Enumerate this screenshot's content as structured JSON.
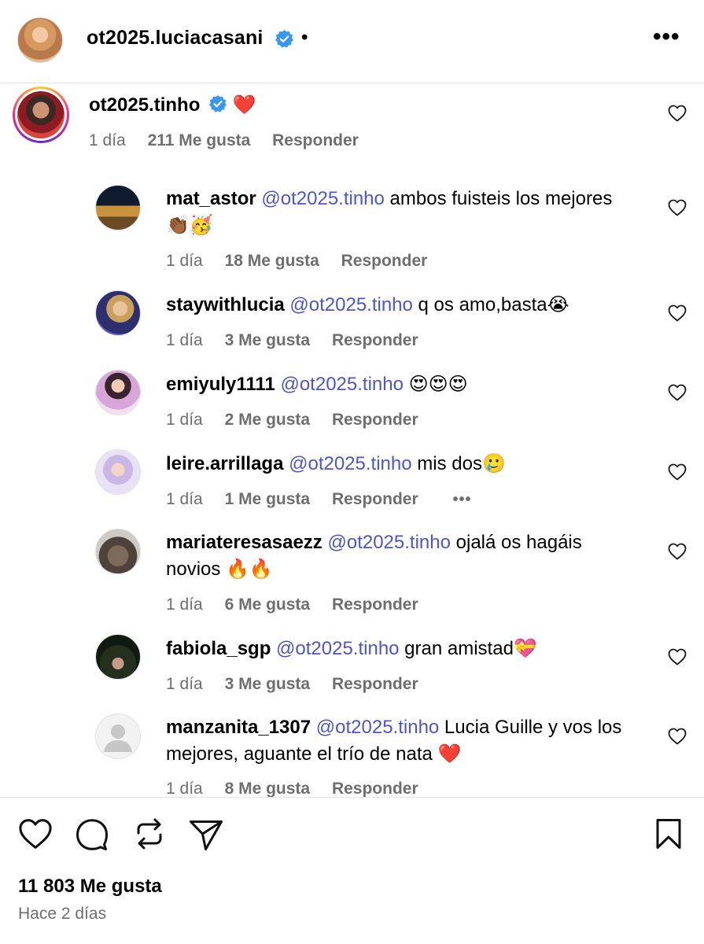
{
  "header": {
    "username": "ot2025.luciacasani",
    "dot": "•",
    "more": "•••"
  },
  "main_comment": {
    "username": "ot2025.tinho",
    "text": "❤️",
    "time": "1 día",
    "likes": "211 Me gusta",
    "reply": "Responder"
  },
  "replies": [
    {
      "username": "mat_astor",
      "mention": "@ot2025.tinho",
      "text": " ambos fuisteis los mejores 👏🏾🥳",
      "time": "1 día",
      "likes": "18 Me gusta",
      "reply": "Responder"
    },
    {
      "username": "staywithlucia",
      "mention": "@ot2025.tinho",
      "text": " q os amo,basta😭",
      "time": "1 día",
      "likes": "3 Me gusta",
      "reply": "Responder"
    },
    {
      "username": "emiyuly1111",
      "mention": "@ot2025.tinho",
      "text": " 😍😍😍",
      "time": "1 día",
      "likes": "2 Me gusta",
      "reply": "Responder"
    },
    {
      "username": "leire.arrillaga",
      "mention": "@ot2025.tinho",
      "text": " mis dos🥲",
      "time": "1 día",
      "likes": "1 Me gusta",
      "reply": "Responder",
      "more": "•••"
    },
    {
      "username": "mariateresasaezz",
      "mention": "@ot2025.tinho",
      "text": " ojalá os hagáis novios 🔥🔥",
      "time": "1 día",
      "likes": "6 Me gusta",
      "reply": "Responder"
    },
    {
      "username": "fabiola_sgp",
      "mention": "@ot2025.tinho",
      "text": " gran amistad💝",
      "time": "1 día",
      "likes": "3 Me gusta",
      "reply": "Responder"
    },
    {
      "username": "manzanita_1307",
      "mention": "@ot2025.tinho",
      "text": " Lucia Guille y vos los mejores, aguante el trío de nata ❤️",
      "time": "1 día",
      "likes": "8 Me gusta",
      "reply": "Responder"
    }
  ],
  "footer": {
    "likes_total": "11 803 Me gusta",
    "posted": "Hace 2 días"
  },
  "icons": [
    "verified-badge-icon",
    "more-options-icon",
    "heart-icon",
    "comment-icon",
    "repost-icon",
    "share-icon",
    "bookmark-icon"
  ],
  "colors": {
    "mention": "#4e55cc",
    "verified": "#3897f0",
    "muted": "#6e6e6e"
  }
}
